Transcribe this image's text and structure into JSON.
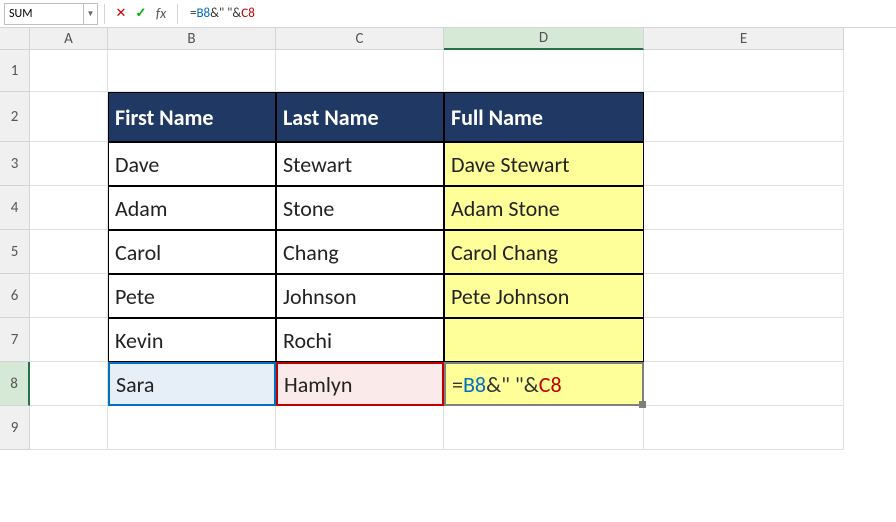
{
  "nameBox": "SUM",
  "formula": {
    "eq": "=",
    "refB": "B8",
    "amp1": "&\" \"&",
    "refC": "C8"
  },
  "columns": [
    "A",
    "B",
    "C",
    "D",
    "E"
  ],
  "rows": [
    "1",
    "2",
    "3",
    "4",
    "5",
    "6",
    "7",
    "8",
    "9"
  ],
  "headers": {
    "b": "First Name",
    "c": "Last Name",
    "d": "Full Name"
  },
  "table": [
    {
      "first": "Dave",
      "last": "Stewart",
      "full": "Dave Stewart"
    },
    {
      "first": "Adam",
      "last": "Stone",
      "full": "Adam Stone"
    },
    {
      "first": "Carol",
      "last": "Chang",
      "full": "Carol Chang"
    },
    {
      "first": "Pete",
      "last": "Johnson",
      "full": "Pete Johnson"
    },
    {
      "first": "Kevin",
      "last": "Rochi",
      "full": ""
    },
    {
      "first": "Sara",
      "last": "Hamlyn",
      "full": ""
    }
  ],
  "chart_data": {
    "type": "table",
    "title": "Concatenation formula example",
    "columns": [
      "First Name",
      "Last Name",
      "Full Name"
    ],
    "rows": [
      [
        "Dave",
        "Stewart",
        "Dave Stewart"
      ],
      [
        "Adam",
        "Stone",
        "Adam Stone"
      ],
      [
        "Carol",
        "Chang",
        "Carol Chang"
      ],
      [
        "Pete",
        "Johnson",
        "Pete Johnson"
      ],
      [
        "Kevin",
        "Rochi",
        ""
      ],
      [
        "Sara",
        "Hamlyn",
        "=B8&\" \"&C8"
      ]
    ]
  }
}
